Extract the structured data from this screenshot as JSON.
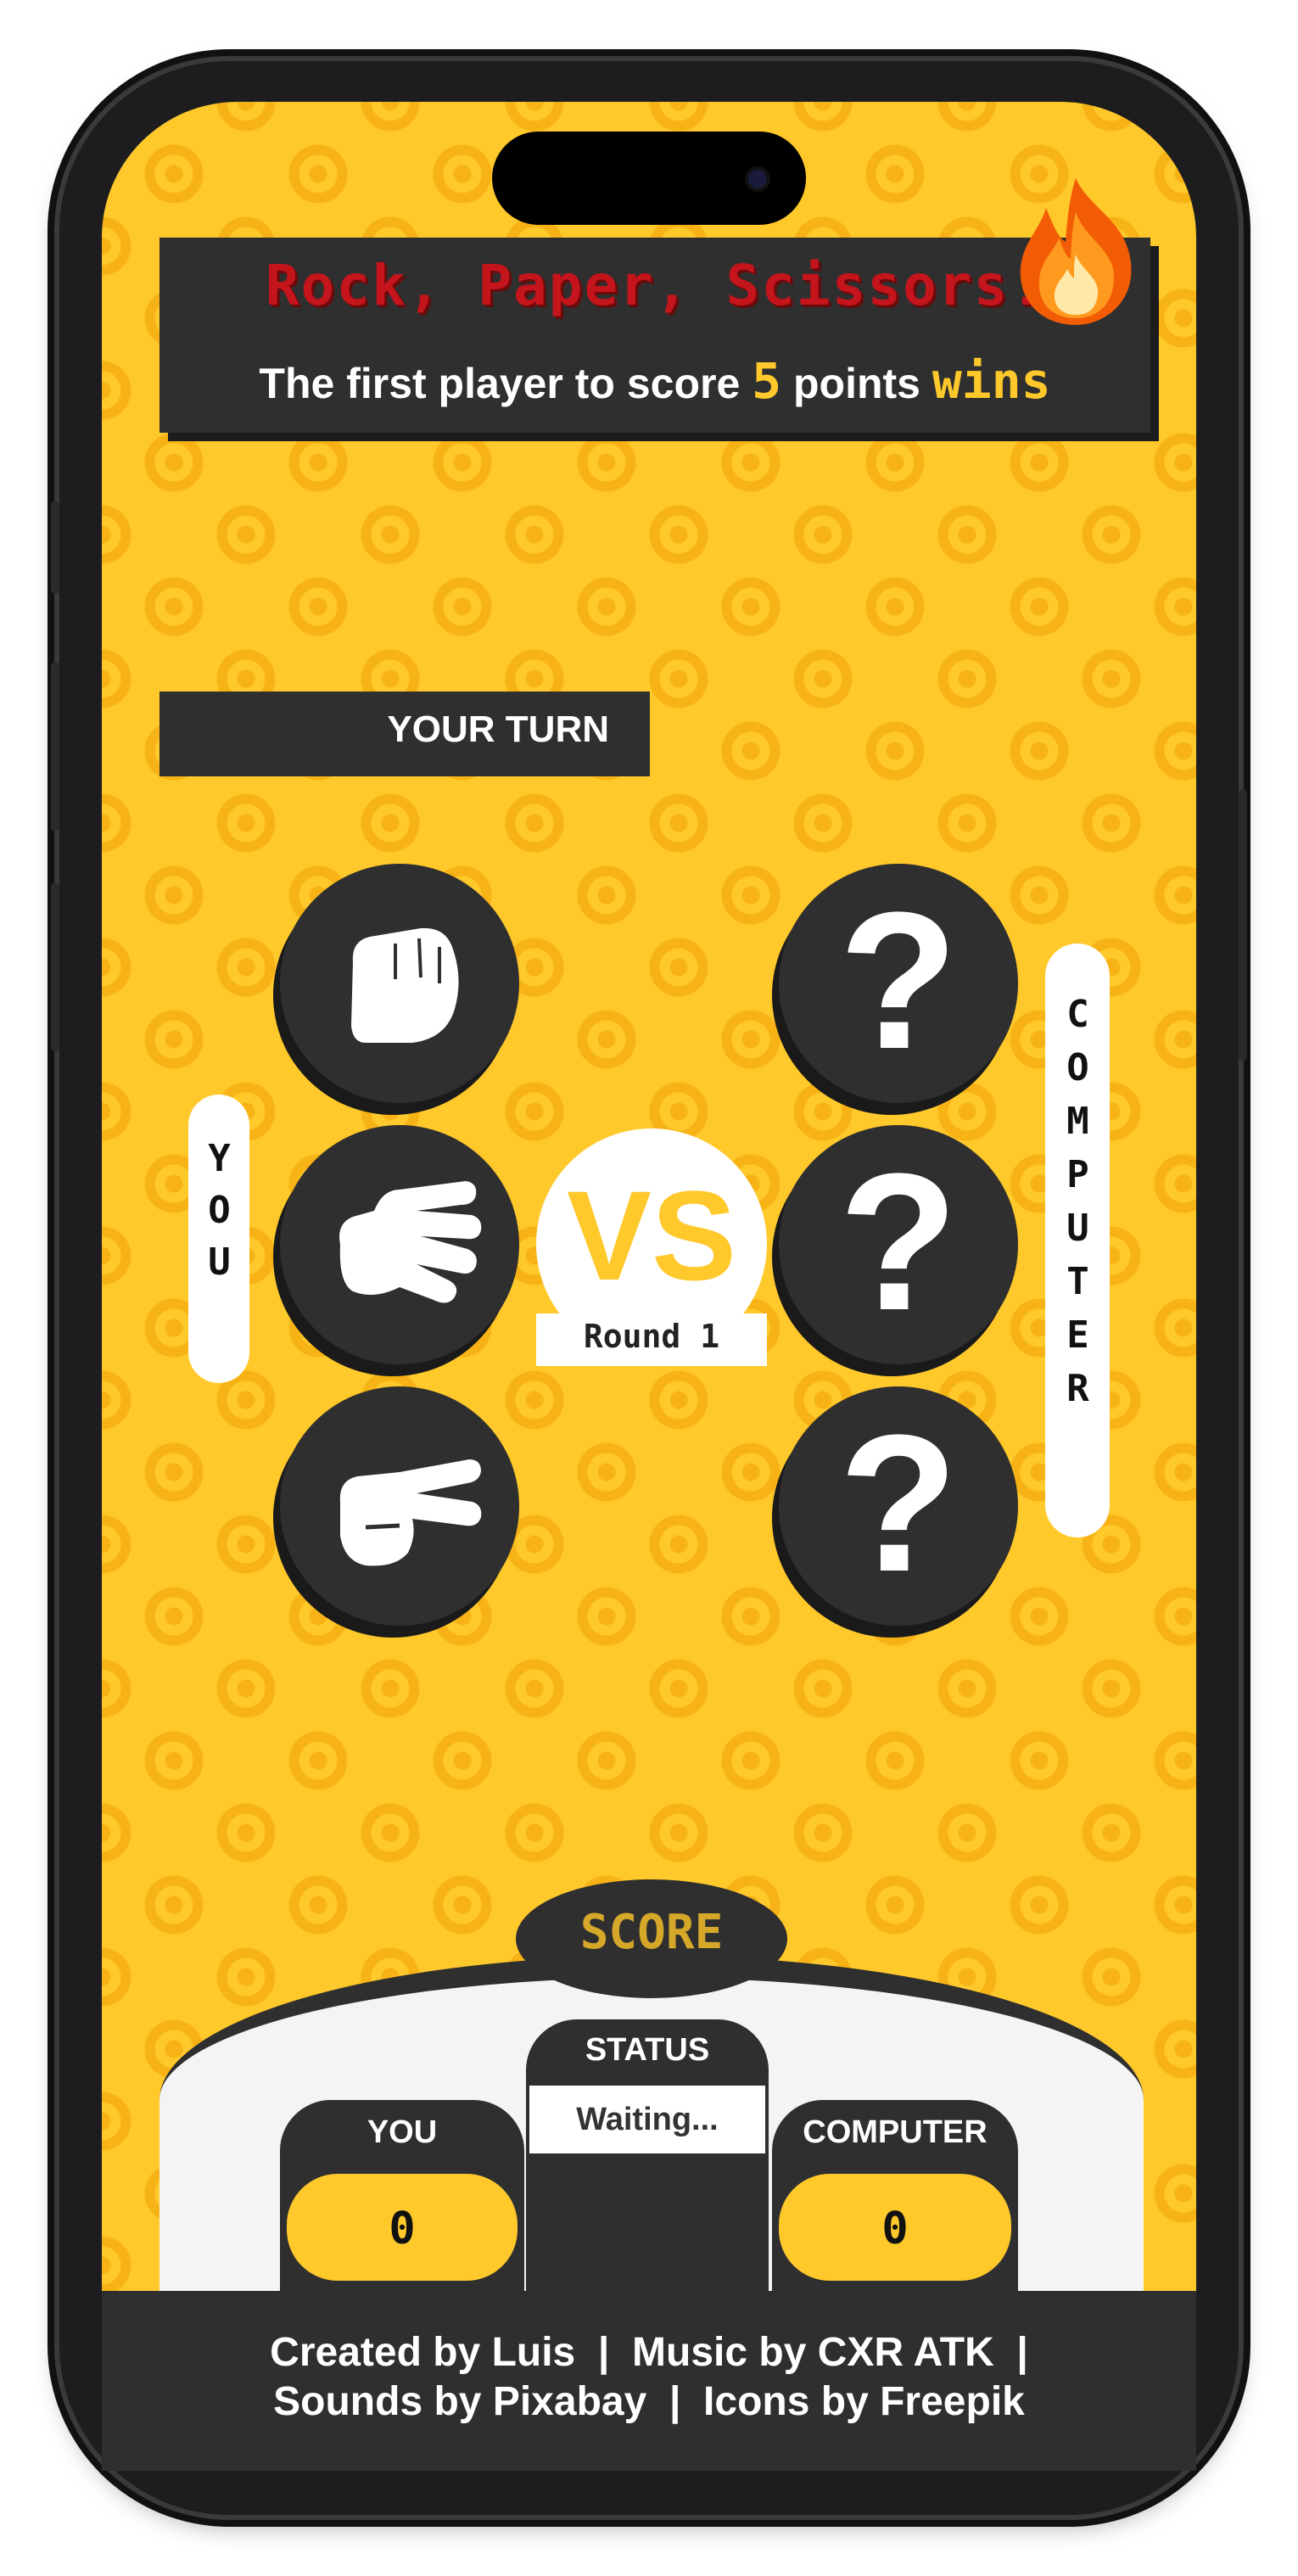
{
  "header": {
    "title": "Rock, Paper, Scissors!",
    "subtitle_prefix": "The first player to score",
    "points_target": "5",
    "subtitle_middle": "points",
    "subtitle_suffix": "wins"
  },
  "turn": {
    "label": "YOUR TURN"
  },
  "player": {
    "label": "YOU",
    "choices": [
      {
        "name": "rock",
        "icon": "fist-icon"
      },
      {
        "name": "paper",
        "icon": "open-hand-icon"
      },
      {
        "name": "scissors",
        "icon": "scissors-hand-icon"
      }
    ]
  },
  "computer": {
    "label": "COMPUTER",
    "choices": [
      "?",
      "?",
      "?"
    ]
  },
  "versus": {
    "label": "VS",
    "round": "Round 1"
  },
  "score": {
    "title": "SCORE",
    "status_label": "STATUS",
    "status_value": "Waiting...",
    "you_label": "YOU",
    "you_value": "0",
    "computer_label": "COMPUTER",
    "computer_value": "0"
  },
  "footer": {
    "line1": "Created by Luis  |  Music by CXR ATK  |",
    "line2": "Sounds by Pixabay  |  Icons by Freepik"
  },
  "colors": {
    "background": "#ffc82b",
    "dark": "#2f2f2f",
    "title_red": "#c4141c"
  }
}
